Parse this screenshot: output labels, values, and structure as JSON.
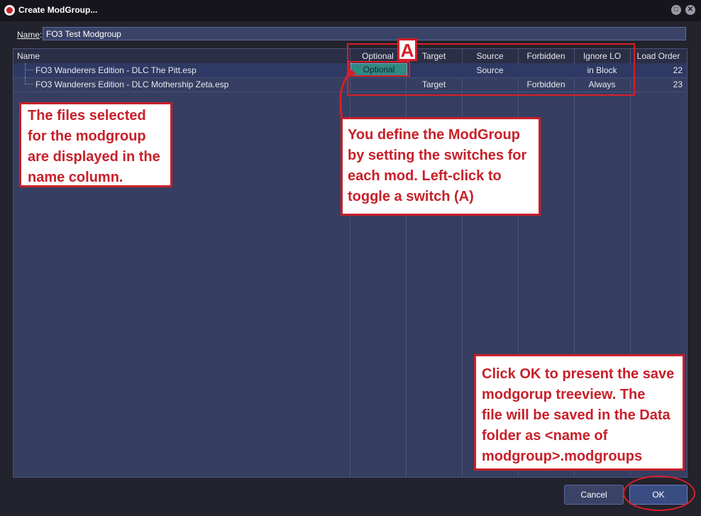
{
  "window": {
    "title": "Create ModGroup...",
    "close_glyph": "✕",
    "max_glyph": "□"
  },
  "name_field": {
    "label": "Name",
    "label_colon": ":",
    "value": "FO3 Test Modgroup"
  },
  "columns": [
    "Name",
    "Optional",
    "Target",
    "Source",
    "Forbidden",
    "Ignore LO",
    "Load Order"
  ],
  "rows": [
    {
      "name": "FO3 Wanderers Edition - DLC The Pitt.esp",
      "optional": "Optional",
      "target": "",
      "source": "Source",
      "forbidden": "",
      "ignore_lo": "in Block",
      "load_order": "22"
    },
    {
      "name": "FO3 Wanderers Edition - DLC Mothership Zeta.esp",
      "optional": "",
      "target": "Target",
      "source": "",
      "forbidden": "Forbidden",
      "ignore_lo": "Always",
      "load_order": "23"
    }
  ],
  "annotations": {
    "badge": "A",
    "files_note": [
      "The files selected",
      "for the modgroup",
      "are displayed in the",
      "name column."
    ],
    "switch_note": [
      "You define the ModGroup",
      "by setting the switches for",
      "each mod. Left-click to",
      "toggle a switch (A)"
    ],
    "ok_note": [
      "Click OK to present the save",
      "modgorup treeview. The",
      "file will be saved in the Data",
      "folder as <name of",
      "modgroup>.modgroups"
    ]
  },
  "buttons": {
    "cancel": "Cancel",
    "ok": "OK"
  },
  "colors": {
    "accent_red": "#d81e28",
    "switch_on": "#2f8a84",
    "grid_bg": "#363e61"
  }
}
